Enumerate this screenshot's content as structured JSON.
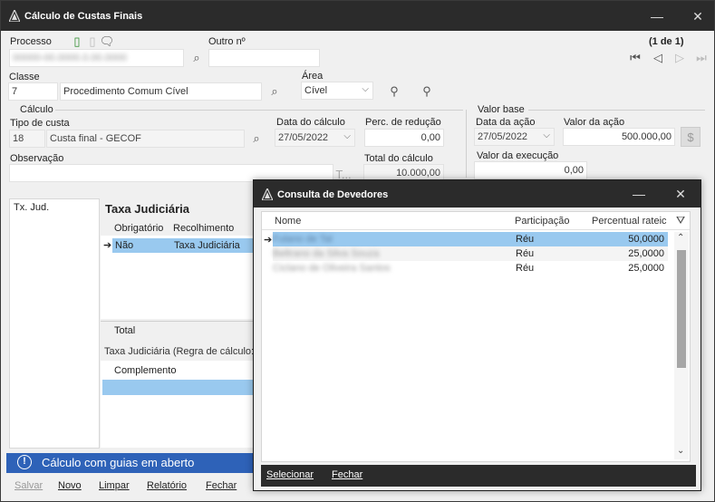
{
  "window": {
    "title": "Cálculo de Custas Finais"
  },
  "header": {
    "processo_label": "Processo",
    "processo_value": "00000-00.0000.0.00.0000",
    "outro_label": "Outro nº",
    "outro_value": "",
    "pager": "(1 de 1)",
    "classe_label": "Classe",
    "classe_code": "7",
    "classe_desc": "Procedimento Comum Cível",
    "area_label": "Área",
    "area_value": "Cível"
  },
  "calculo": {
    "group_label": "Cálculo",
    "tipo_label": "Tipo de custa",
    "tipo_code": "18",
    "tipo_desc": "Custa final - GECOF",
    "data_label": "Data do cálculo",
    "data_value": "27/05/2022",
    "perc_label": "Perc. de redução",
    "perc_value": "0,00",
    "obs_label": "Observação",
    "obs_value": "",
    "total_label": "Total do cálculo",
    "total_value": "10.000,00"
  },
  "valor_base": {
    "group_label": "Valor base",
    "data_acao_label": "Data da ação",
    "data_acao_value": "27/05/2022",
    "valor_acao_label": "Valor da ação",
    "valor_acao_value": "500.000,00",
    "valor_exec_label": "Valor da execução",
    "valor_exec_value": "0,00"
  },
  "left_list": {
    "items": [
      "Tx. Jud."
    ]
  },
  "taxa": {
    "title": "Taxa Judiciária",
    "col_obrigatorio": "Obrigatório",
    "col_recolhimento": "Recolhimento",
    "row_obrigatorio": "Não",
    "row_recolhimento": "Taxa Judiciária",
    "total_label": "Total",
    "regra_label": "Taxa Judiciária (Regra de cálculo:",
    "complemento_label": "Complemento"
  },
  "status": {
    "message": "Cálculo com guias em aberto"
  },
  "actions": {
    "salvar": "Salvar",
    "novo": "Novo",
    "limpar": "Limpar",
    "relatorio": "Relatório",
    "fechar": "Fechar"
  },
  "modal": {
    "title": "Consulta de Devedores",
    "columns": {
      "nome": "Nome",
      "participacao": "Participação",
      "percentual": "Percentual rateic"
    },
    "rows": [
      {
        "nome": "Fulano de Tal",
        "participacao": "Réu",
        "percentual": "50,0000"
      },
      {
        "nome": "Beltrano da Silva Souza",
        "participacao": "Réu",
        "percentual": "25,0000"
      },
      {
        "nome": "Ciclano de Oliveira Santos",
        "participacao": "Réu",
        "percentual": "25,0000"
      }
    ],
    "footer": {
      "selecionar": "Selecionar",
      "fechar": "Fechar"
    }
  },
  "colors": {
    "titlebar": "#2b2b2b",
    "selection": "#99c9ef",
    "status": "#2e62b8"
  }
}
